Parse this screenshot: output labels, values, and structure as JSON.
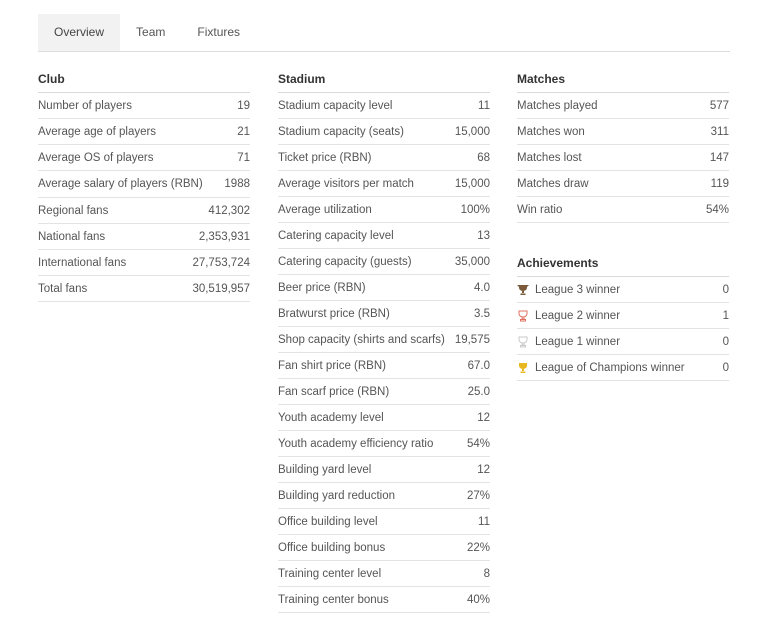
{
  "tabs": [
    {
      "label": "Overview"
    },
    {
      "label": "Team"
    },
    {
      "label": "Fixtures"
    }
  ],
  "club": {
    "title": "Club",
    "rows": [
      {
        "label": "Number of players",
        "value": "19"
      },
      {
        "label": "Average age of players",
        "value": "21"
      },
      {
        "label": "Average OS of players",
        "value": "71"
      },
      {
        "label": "Average salary of players (RBN)",
        "value": "1988"
      },
      {
        "label": "Regional fans",
        "value": "412,302"
      },
      {
        "label": "National fans",
        "value": "2,353,931"
      },
      {
        "label": "International fans",
        "value": "27,753,724"
      },
      {
        "label": "Total fans",
        "value": "30,519,957"
      }
    ]
  },
  "stadium": {
    "title": "Stadium",
    "rows": [
      {
        "label": "Stadium capacity level",
        "value": "11"
      },
      {
        "label": "Stadium capacity (seats)",
        "value": "15,000"
      },
      {
        "label": "Ticket price (RBN)",
        "value": "68"
      },
      {
        "label": "Average visitors per match",
        "value": "15,000"
      },
      {
        "label": "Average utilization",
        "value": "100%"
      },
      {
        "label": "Catering capacity level",
        "value": "13"
      },
      {
        "label": "Catering capacity (guests)",
        "value": "35,000"
      },
      {
        "label": "Beer price (RBN)",
        "value": "4.0"
      },
      {
        "label": "Bratwurst price (RBN)",
        "value": "3.5"
      },
      {
        "label": "Shop capacity (shirts and scarfs)",
        "value": "19,575"
      },
      {
        "label": "Fan shirt price (RBN)",
        "value": "67.0"
      },
      {
        "label": "Fan scarf price (RBN)",
        "value": "25.0"
      },
      {
        "label": "Youth academy level",
        "value": "12"
      },
      {
        "label": "Youth academy efficiency ratio",
        "value": "54%"
      },
      {
        "label": "Building yard level",
        "value": "12"
      },
      {
        "label": "Building yard reduction",
        "value": "27%"
      },
      {
        "label": "Office building level",
        "value": "11"
      },
      {
        "label": "Office building bonus",
        "value": "22%"
      },
      {
        "label": "Training center level",
        "value": "8"
      },
      {
        "label": "Training center bonus",
        "value": "40%"
      }
    ]
  },
  "matches": {
    "title": "Matches",
    "rows": [
      {
        "label": "Matches played",
        "value": "577"
      },
      {
        "label": "Matches won",
        "value": "311"
      },
      {
        "label": "Matches lost",
        "value": "147"
      },
      {
        "label": "Matches draw",
        "value": "119"
      },
      {
        "label": "Win ratio",
        "value": "54%"
      }
    ]
  },
  "achievements": {
    "title": "Achievements",
    "rows": [
      {
        "label": "League 3 winner",
        "value": "0",
        "icon": "trophy-bronze-icon",
        "color": "#7a5a3a"
      },
      {
        "label": "League 2 winner",
        "value": "1",
        "icon": "trophy-red-icon",
        "color": "#e07060"
      },
      {
        "label": "League 1 winner",
        "value": "0",
        "icon": "trophy-silver-icon",
        "color": "#c8c8c8"
      },
      {
        "label": "League of Champions winner",
        "value": "0",
        "icon": "trophy-gold-icon",
        "color": "#e8b820"
      }
    ]
  }
}
